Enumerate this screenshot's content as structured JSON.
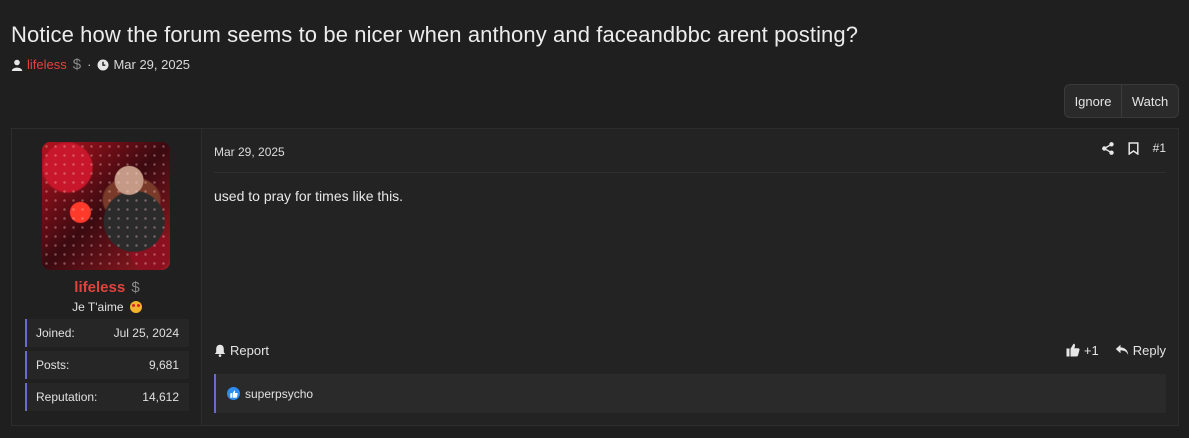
{
  "thread": {
    "title": "Notice how the forum seems to be nicer when anthony and faceandbbc arent posting?",
    "author": "lifeless",
    "author_badge": "$",
    "separator": "·",
    "date": "Mar 29, 2025"
  },
  "thread_buttons": {
    "ignore": "Ignore",
    "watch": "Watch"
  },
  "post": {
    "user": {
      "name": "lifeless",
      "badge": "$",
      "title": "Je T'aime",
      "stats": [
        {
          "label": "Joined:",
          "value": "Jul 25, 2024"
        },
        {
          "label": "Posts:",
          "value": "9,681"
        },
        {
          "label": "Reputation:",
          "value": "14,612"
        }
      ]
    },
    "date": "Mar 29, 2025",
    "number": "#1",
    "body": "used to pray for times like this.",
    "report_label": "Report",
    "like_count": "+1",
    "reply_label": "Reply",
    "reactions_by": "superpsycho"
  },
  "icons": {
    "user": "user-icon",
    "clock": "clock-icon",
    "share": "share-icon",
    "bookmark": "bookmark-icon",
    "bell": "bell-icon",
    "thumbs_up": "thumbs-up-icon",
    "reply": "reply-icon",
    "like_badge": "like-badge-icon"
  },
  "colors": {
    "username": "#e0443c",
    "accent_border": "#6a6ad0",
    "like_blue": "#2d8cf0",
    "background": "#1f1f1f"
  }
}
